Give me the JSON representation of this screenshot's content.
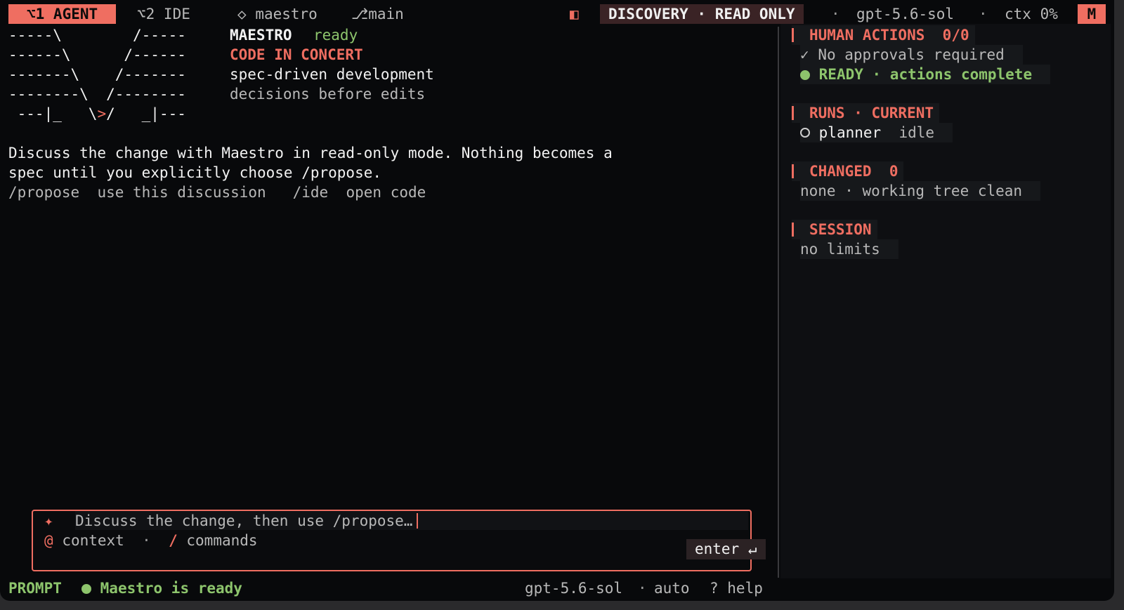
{
  "topbar": {
    "tab_agent": "⌥1 AGENT",
    "tab_ide": "⌥2 IDE",
    "repo_icon": "◇",
    "repo": "maestro",
    "branch_icon": "⎇",
    "branch": "main",
    "mode_icon": "◧",
    "mode": "DISCOVERY · READ ONLY",
    "sep1": "·",
    "model": "gpt-5.6-sol",
    "sep2": "·",
    "ctx": "ctx 0%",
    "badge": "M"
  },
  "banner": {
    "art": [
      "-----\\        /-----",
      "------\\      /------",
      "-------\\    /-------",
      "--------\\  /--------",
      " ---|_   \\",
      ">",
      "/   _|---"
    ],
    "product": "MAESTRO",
    "status": "ready",
    "tagline": "CODE IN CONCERT",
    "line3": "spec-driven development",
    "line4": "decisions before edits"
  },
  "intro": {
    "line1": "Discuss the change with Maestro in read-only mode. Nothing becomes a",
    "line2": "spec until you explicitly choose /propose.",
    "hint1_cmd": "/propose",
    "hint1_desc": "use this discussion",
    "hint2_cmd": "/ide",
    "hint2_desc": "open code"
  },
  "sidebar": {
    "human_actions": {
      "title": "HUMAN ACTIONS",
      "count": "0/0",
      "check_icon": "✓",
      "line1": "No approvals required",
      "line2": "READY · actions complete"
    },
    "runs": {
      "title": "RUNS · CURRENT",
      "agent": "planner",
      "state": "idle"
    },
    "changed": {
      "title": "CHANGED",
      "count": "0",
      "line": "none · working tree clean"
    },
    "session": {
      "title": "SESSION",
      "line": "no limits"
    }
  },
  "composer": {
    "sparkle": "✦",
    "placeholder": "Discuss the change, then use /propose…",
    "at": "@",
    "context_label": "context",
    "dot": "·",
    "slash": "/",
    "commands_label": "commands",
    "enter_label": "enter ↵"
  },
  "statusbar": {
    "prompt": "PROMPT",
    "message": "Maestro is ready",
    "model": "gpt-5.6-sol",
    "sep": "·",
    "mode": "auto",
    "help": "? help"
  }
}
